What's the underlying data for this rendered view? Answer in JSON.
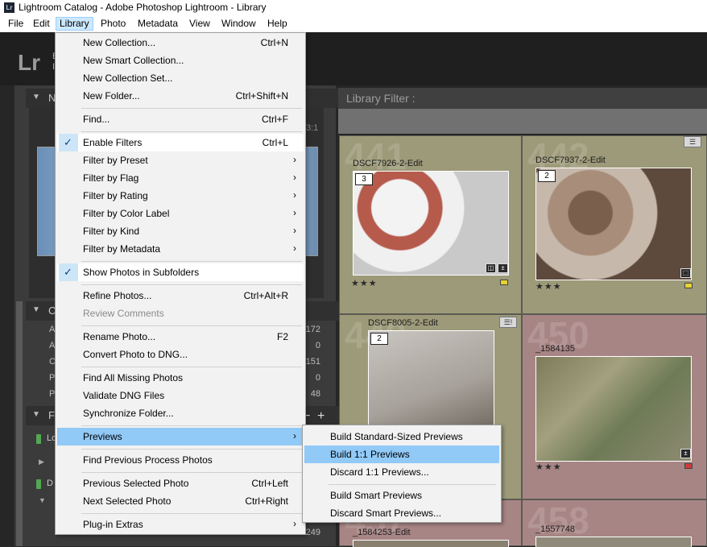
{
  "window": {
    "title": "Lightroom Catalog - Adobe Photoshop Lightroom - Library",
    "app_icon": "Lr"
  },
  "menubar": [
    "File",
    "Edit",
    "Library",
    "Photo",
    "Metadata",
    "View",
    "Window",
    "Help"
  ],
  "lr": {
    "logo": "Lr",
    "id_line1": "E",
    "id_line2": "I"
  },
  "left_panel": {
    "navigator_letter": "N",
    "navigator_zoom": "3:1",
    "catalog_letter": "C",
    "catalog_rows": [
      {
        "label": "A",
        "count": "9172"
      },
      {
        "label": "A",
        "count": "0"
      },
      {
        "label": "C",
        "count": "151"
      },
      {
        "label": "P",
        "count": "0"
      },
      {
        "label": "P",
        "count": "48"
      }
    ],
    "folders_letter": "F",
    "folder_rows": [
      {
        "name": "Lo"
      },
      {
        "name": "D"
      }
    ],
    "bottom_count": "249"
  },
  "library_filter": {
    "label": "Library Filter :"
  },
  "grid": {
    "cells": [
      {
        "number": "441",
        "name": "DSCF7926-2-Edit",
        "stack": "3",
        "stars": "★★★",
        "label_color": "#e8d232"
      },
      {
        "number": "442",
        "name": "DSCF7937-2-Edit",
        "stack": "2",
        "stars": "★★★",
        "label_color": "#e8d232"
      },
      {
        "number": "449",
        "name": "DSCF8005-2-Edit",
        "stack": "2",
        "stars": "",
        "label_color": ""
      },
      {
        "number": "450",
        "name": "_1584135",
        "stack": "",
        "stars": "★★★",
        "label_color": "#d23a3a"
      },
      {
        "number": "457",
        "name": "_1584253-Edit",
        "stack": "",
        "stars": "",
        "label_color": ""
      },
      {
        "number": "458",
        "name": "_1557748",
        "stack": "",
        "stars": "",
        "label_color": ""
      }
    ]
  },
  "library_menu": {
    "items": [
      {
        "label": "New Collection...",
        "shortcut": "Ctrl+N"
      },
      {
        "label": "New Smart Collection...",
        "shortcut": ""
      },
      {
        "label": "New Collection Set...",
        "shortcut": ""
      },
      {
        "label": "New Folder...",
        "shortcut": "Ctrl+Shift+N"
      },
      {
        "label": "Find...",
        "shortcut": "Ctrl+F"
      },
      {
        "label": "Enable Filters",
        "shortcut": "Ctrl+L",
        "checked": true
      },
      {
        "label": "Filter by Preset",
        "submenu": true
      },
      {
        "label": "Filter by Flag",
        "submenu": true
      },
      {
        "label": "Filter by Rating",
        "submenu": true
      },
      {
        "label": "Filter by Color Label",
        "submenu": true
      },
      {
        "label": "Filter by Kind",
        "submenu": true
      },
      {
        "label": "Filter by Metadata",
        "submenu": true
      },
      {
        "label": "Show Photos in Subfolders",
        "checked": true
      },
      {
        "label": "Refine Photos...",
        "shortcut": "Ctrl+Alt+R"
      },
      {
        "label": "Review Comments",
        "disabled": true
      },
      {
        "label": "Rename Photo...",
        "shortcut": "F2"
      },
      {
        "label": "Convert Photo to DNG..."
      },
      {
        "label": "Find All Missing Photos"
      },
      {
        "label": "Validate DNG Files"
      },
      {
        "label": "Synchronize Folder..."
      },
      {
        "label": "Previews",
        "submenu": true,
        "highlighted": true
      },
      {
        "label": "Find Previous Process Photos"
      },
      {
        "label": "Previous Selected Photo",
        "shortcut": "Ctrl+Left"
      },
      {
        "label": "Next Selected Photo",
        "shortcut": "Ctrl+Right"
      },
      {
        "label": "Plug-in Extras",
        "submenu": true
      }
    ]
  },
  "previews_submenu": {
    "items": [
      {
        "label": "Build Standard-Sized Previews"
      },
      {
        "label": "Build 1:1 Previews",
        "highlighted": true
      },
      {
        "label": "Discard 1:1 Previews..."
      },
      {
        "label": "Build Smart Previews"
      },
      {
        "label": "Discard Smart Previews..."
      }
    ]
  },
  "glyphs": {
    "check": "✓",
    "arrow": "›",
    "tri_down": "▼",
    "tri_right": "▶",
    "plus": "+",
    "minus": "−"
  }
}
